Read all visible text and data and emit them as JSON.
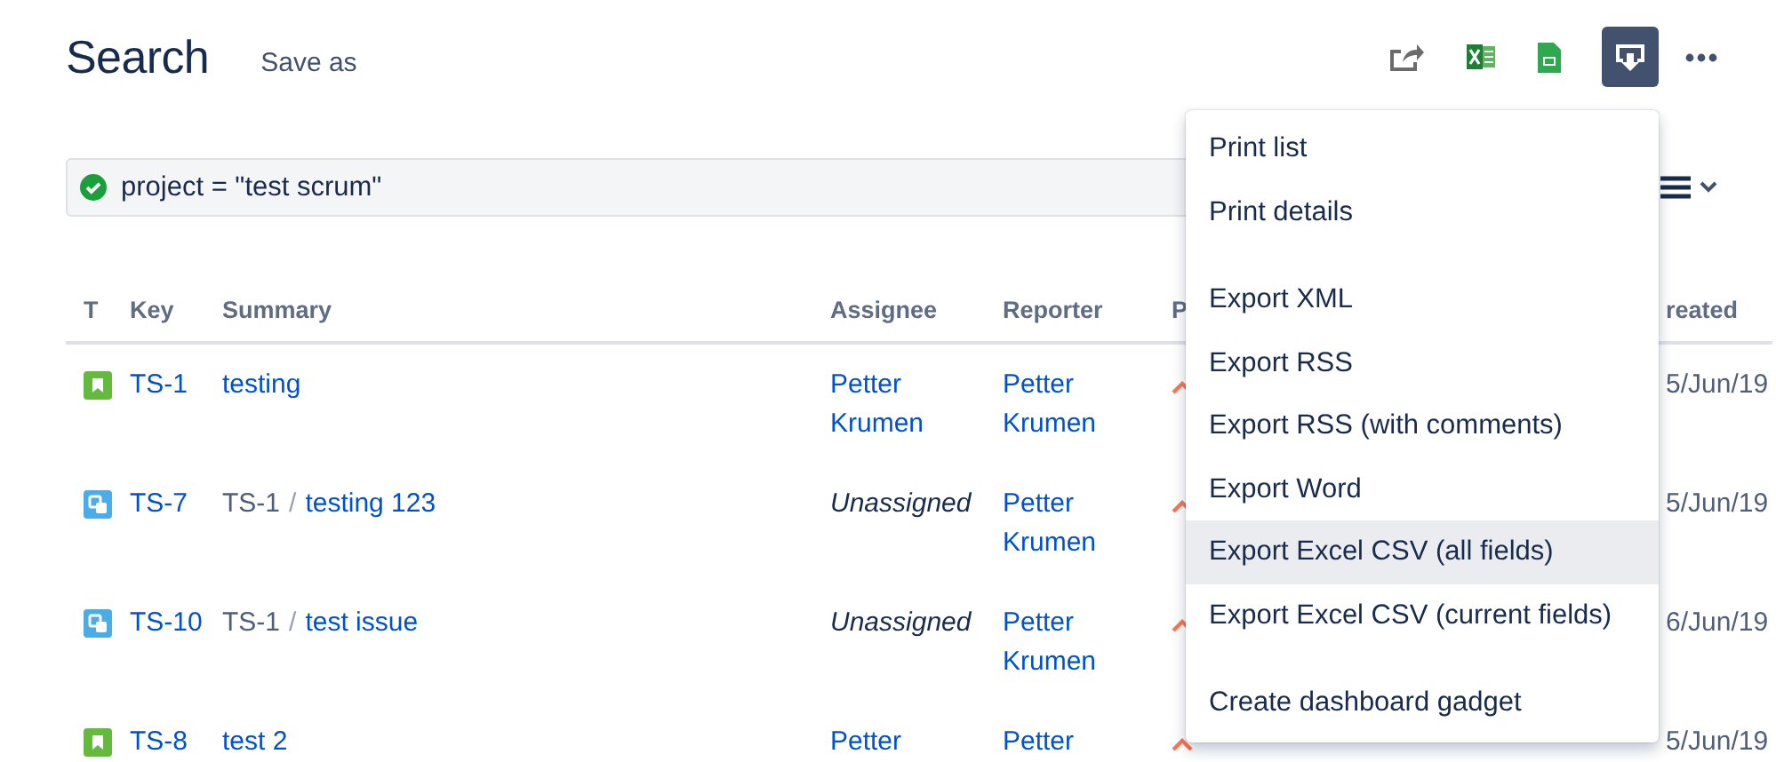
{
  "header": {
    "title": "Search",
    "save_as": "Save as"
  },
  "toolbar": {
    "export_button": {
      "selected": true
    }
  },
  "query": {
    "value": "project = \"test scrum\"",
    "valid": true
  },
  "table": {
    "columns": [
      "T",
      "Key",
      "Summary",
      "Assignee",
      "Reporter",
      "P",
      "reated"
    ],
    "rows": [
      {
        "kind": "story",
        "key": "TS-1",
        "summary": "testing",
        "assignee": "Petter Krumen",
        "assignee_unassigned": false,
        "reporter": "Petter Krumen",
        "created": "5/Jun/19"
      },
      {
        "kind": "subtask",
        "key": "TS-7",
        "parent": "TS-1",
        "separator": "/",
        "summary": "testing 123",
        "assignee": "Unassigned",
        "assignee_unassigned": true,
        "reporter": "Petter Krumen",
        "created": "5/Jun/19"
      },
      {
        "kind": "subtask",
        "key": "TS-10",
        "parent": "TS-1",
        "separator": "/",
        "summary": "test issue",
        "assignee": "Unassigned",
        "assignee_unassigned": true,
        "reporter": "Petter Krumen",
        "created": "6/Jun/19"
      },
      {
        "kind": "story",
        "key": "TS-8",
        "summary": "test 2",
        "assignee": "Petter",
        "assignee_unassigned": false,
        "reporter": "Petter",
        "created": "5/Jun/19"
      }
    ]
  },
  "export_menu": {
    "groups": [
      [
        {
          "label": "Print list",
          "highlighted": false
        },
        {
          "label": "Print details",
          "highlighted": false
        }
      ],
      [
        {
          "label": "Export XML",
          "highlighted": false
        },
        {
          "label": "Export RSS",
          "highlighted": false
        },
        {
          "label": "Export RSS (with comments)",
          "highlighted": false
        },
        {
          "label": "Export Word",
          "highlighted": false
        },
        {
          "label": "Export Excel CSV (all fields)",
          "highlighted": true
        },
        {
          "label": "Export Excel CSV (current fields)",
          "highlighted": false
        }
      ],
      [
        {
          "label": "Create dashboard gadget",
          "highlighted": false
        }
      ]
    ]
  }
}
